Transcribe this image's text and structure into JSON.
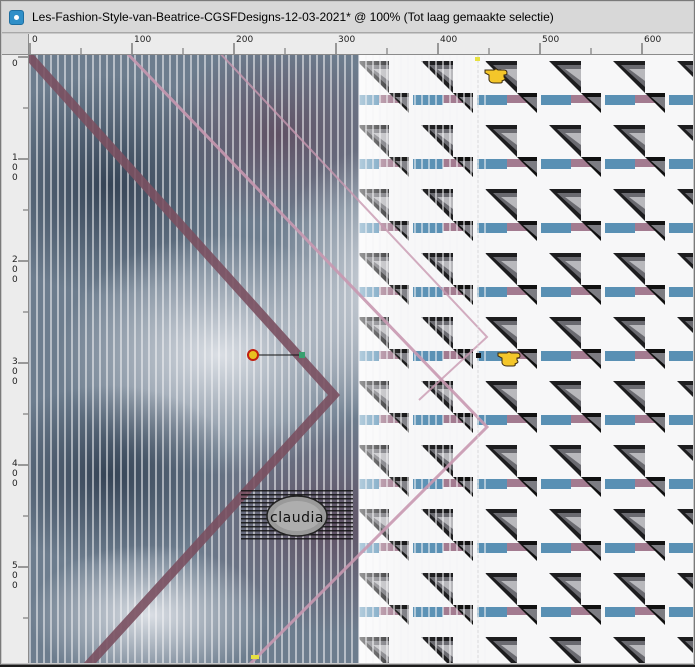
{
  "window": {
    "title": "Les-Fashion-Style-van-Beatrice-CGSFDesigns-12-03-2021* @ 100% (Tot laag gemaakte selectie)"
  },
  "ruler": {
    "top_labels": [
      "0",
      "100",
      "200",
      "300",
      "400",
      "500",
      "600"
    ],
    "left_labels": [
      "0",
      "1\n0\n0",
      "2\n0\n0",
      "3\n0\n0",
      "4\n0\n0",
      "5\n0\n0"
    ]
  },
  "canvas": {
    "watermark_text": "claudia",
    "colors": {
      "background_blue": "#5d6d7d",
      "stripe_white": "#f4f4f6",
      "mauve": "#7a5060",
      "pink_line": "#c898b0",
      "pattern_blue": "#3d7ea8",
      "pattern_black": "#111111"
    }
  },
  "handles": {
    "pointer_icon": "pointing-hand-icon"
  }
}
